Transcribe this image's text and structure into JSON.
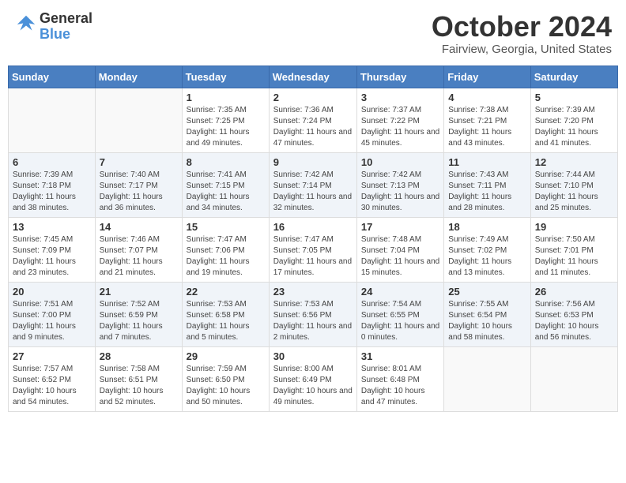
{
  "header": {
    "logo_line1": "General",
    "logo_line2": "Blue",
    "month": "October 2024",
    "location": "Fairview, Georgia, United States"
  },
  "days_of_week": [
    "Sunday",
    "Monday",
    "Tuesday",
    "Wednesday",
    "Thursday",
    "Friday",
    "Saturday"
  ],
  "weeks": [
    [
      {
        "day": "",
        "info": ""
      },
      {
        "day": "",
        "info": ""
      },
      {
        "day": "1",
        "info": "Sunrise: 7:35 AM\nSunset: 7:25 PM\nDaylight: 11 hours and 49 minutes."
      },
      {
        "day": "2",
        "info": "Sunrise: 7:36 AM\nSunset: 7:24 PM\nDaylight: 11 hours and 47 minutes."
      },
      {
        "day": "3",
        "info": "Sunrise: 7:37 AM\nSunset: 7:22 PM\nDaylight: 11 hours and 45 minutes."
      },
      {
        "day": "4",
        "info": "Sunrise: 7:38 AM\nSunset: 7:21 PM\nDaylight: 11 hours and 43 minutes."
      },
      {
        "day": "5",
        "info": "Sunrise: 7:39 AM\nSunset: 7:20 PM\nDaylight: 11 hours and 41 minutes."
      }
    ],
    [
      {
        "day": "6",
        "info": "Sunrise: 7:39 AM\nSunset: 7:18 PM\nDaylight: 11 hours and 38 minutes."
      },
      {
        "day": "7",
        "info": "Sunrise: 7:40 AM\nSunset: 7:17 PM\nDaylight: 11 hours and 36 minutes."
      },
      {
        "day": "8",
        "info": "Sunrise: 7:41 AM\nSunset: 7:15 PM\nDaylight: 11 hours and 34 minutes."
      },
      {
        "day": "9",
        "info": "Sunrise: 7:42 AM\nSunset: 7:14 PM\nDaylight: 11 hours and 32 minutes."
      },
      {
        "day": "10",
        "info": "Sunrise: 7:42 AM\nSunset: 7:13 PM\nDaylight: 11 hours and 30 minutes."
      },
      {
        "day": "11",
        "info": "Sunrise: 7:43 AM\nSunset: 7:11 PM\nDaylight: 11 hours and 28 minutes."
      },
      {
        "day": "12",
        "info": "Sunrise: 7:44 AM\nSunset: 7:10 PM\nDaylight: 11 hours and 25 minutes."
      }
    ],
    [
      {
        "day": "13",
        "info": "Sunrise: 7:45 AM\nSunset: 7:09 PM\nDaylight: 11 hours and 23 minutes."
      },
      {
        "day": "14",
        "info": "Sunrise: 7:46 AM\nSunset: 7:07 PM\nDaylight: 11 hours and 21 minutes."
      },
      {
        "day": "15",
        "info": "Sunrise: 7:47 AM\nSunset: 7:06 PM\nDaylight: 11 hours and 19 minutes."
      },
      {
        "day": "16",
        "info": "Sunrise: 7:47 AM\nSunset: 7:05 PM\nDaylight: 11 hours and 17 minutes."
      },
      {
        "day": "17",
        "info": "Sunrise: 7:48 AM\nSunset: 7:04 PM\nDaylight: 11 hours and 15 minutes."
      },
      {
        "day": "18",
        "info": "Sunrise: 7:49 AM\nSunset: 7:02 PM\nDaylight: 11 hours and 13 minutes."
      },
      {
        "day": "19",
        "info": "Sunrise: 7:50 AM\nSunset: 7:01 PM\nDaylight: 11 hours and 11 minutes."
      }
    ],
    [
      {
        "day": "20",
        "info": "Sunrise: 7:51 AM\nSunset: 7:00 PM\nDaylight: 11 hours and 9 minutes."
      },
      {
        "day": "21",
        "info": "Sunrise: 7:52 AM\nSunset: 6:59 PM\nDaylight: 11 hours and 7 minutes."
      },
      {
        "day": "22",
        "info": "Sunrise: 7:53 AM\nSunset: 6:58 PM\nDaylight: 11 hours and 5 minutes."
      },
      {
        "day": "23",
        "info": "Sunrise: 7:53 AM\nSunset: 6:56 PM\nDaylight: 11 hours and 2 minutes."
      },
      {
        "day": "24",
        "info": "Sunrise: 7:54 AM\nSunset: 6:55 PM\nDaylight: 11 hours and 0 minutes."
      },
      {
        "day": "25",
        "info": "Sunrise: 7:55 AM\nSunset: 6:54 PM\nDaylight: 10 hours and 58 minutes."
      },
      {
        "day": "26",
        "info": "Sunrise: 7:56 AM\nSunset: 6:53 PM\nDaylight: 10 hours and 56 minutes."
      }
    ],
    [
      {
        "day": "27",
        "info": "Sunrise: 7:57 AM\nSunset: 6:52 PM\nDaylight: 10 hours and 54 minutes."
      },
      {
        "day": "28",
        "info": "Sunrise: 7:58 AM\nSunset: 6:51 PM\nDaylight: 10 hours and 52 minutes."
      },
      {
        "day": "29",
        "info": "Sunrise: 7:59 AM\nSunset: 6:50 PM\nDaylight: 10 hours and 50 minutes."
      },
      {
        "day": "30",
        "info": "Sunrise: 8:00 AM\nSunset: 6:49 PM\nDaylight: 10 hours and 49 minutes."
      },
      {
        "day": "31",
        "info": "Sunrise: 8:01 AM\nSunset: 6:48 PM\nDaylight: 10 hours and 47 minutes."
      },
      {
        "day": "",
        "info": ""
      },
      {
        "day": "",
        "info": ""
      }
    ]
  ]
}
